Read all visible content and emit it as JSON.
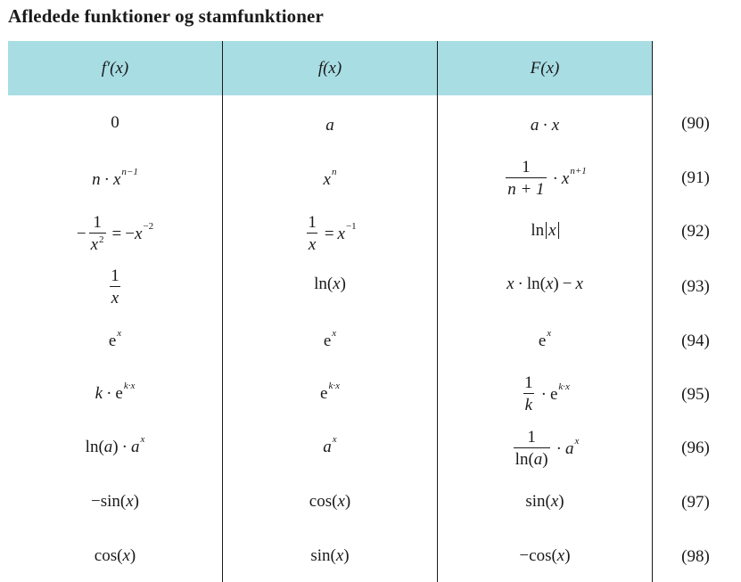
{
  "title": "Afledede funktioner og stamfunktioner",
  "headers": {
    "col1": "f′(x)",
    "col2": "f(x)",
    "col3": "F(x)"
  },
  "rows": [
    {
      "num": "(90)",
      "d_const": "0",
      "f_var": "a",
      "F_a": "a",
      "F_x": "x"
    },
    {
      "num": "(91)",
      "d_n": "n",
      "d_x": "x",
      "d_exp": "n−1",
      "f_x": "x",
      "f_exp": "n",
      "F_num": "1",
      "F_den": "n + 1",
      "F_x": "x",
      "F_exp": "n+1"
    },
    {
      "num": "(92)",
      "d_num": "1",
      "d_den_x": "x",
      "d_den_exp": "2",
      "d_rhs_x": "x",
      "d_rhs_exp": "−2",
      "f_num": "1",
      "f_den": "x",
      "f_rhs_x": "x",
      "f_rhs_exp": "−1",
      "F_ln": "ln",
      "F_x": "x"
    },
    {
      "num": "(93)",
      "d_num": "1",
      "d_den": "x",
      "f_ln": "ln(",
      "f_x": "x",
      "f_close": ")",
      "F_x1": "x",
      "F_ln": "ln(",
      "F_x2": "x",
      "F_close": ")",
      "F_x3": "x"
    },
    {
      "num": "(94)",
      "d_e": "e",
      "d_exp": "x",
      "f_e": "e",
      "f_exp": "x",
      "F_e": "e",
      "F_exp": "x"
    },
    {
      "num": "(95)",
      "d_k": "k",
      "d_e": "e",
      "d_exp": "k·x",
      "f_e": "e",
      "f_exp": "k·x",
      "F_num": "1",
      "F_den": "k",
      "F_e": "e",
      "F_exp": "k·x"
    },
    {
      "num": "(96)",
      "d_ln": "ln(",
      "d_a": "a",
      "d_close": ")",
      "d_base": "a",
      "d_exp": "x",
      "f_a": "a",
      "f_exp": "x",
      "F_num": "1",
      "F_den_ln": "ln(",
      "F_den_a": "a",
      "F_den_close": ")",
      "F_base": "a",
      "F_exp": "x"
    },
    {
      "num": "(97)",
      "d_text": "−sin(",
      "d_x": "x",
      "d_close": ")",
      "f_text": "cos(",
      "f_x": "x",
      "f_close": ")",
      "F_text": "sin(",
      "F_x": "x",
      "F_close": ")"
    },
    {
      "num": "(98)",
      "d_text": "cos(",
      "d_x": "x",
      "d_close": ")",
      "f_text": "sin(",
      "f_x": "x",
      "f_close": ")",
      "F_text": "−cos(",
      "F_x": "x",
      "F_close": ")"
    }
  ]
}
